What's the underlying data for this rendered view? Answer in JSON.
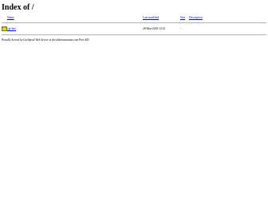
{
  "title": "Index of /",
  "columns": {
    "name": "Name",
    "last_modified": "Last modified",
    "size": "Size",
    "description": "Description"
  },
  "entries": [
    {
      "icon": "folder-icon",
      "name": "cgi-bin/",
      "last_modified": "28-Mar-2018 10:15",
      "size": "-",
      "description": ""
    }
  ],
  "footer": "Proudly Served by LiteSpeed Web Server at fitvalitemvaanana.com Port 443"
}
